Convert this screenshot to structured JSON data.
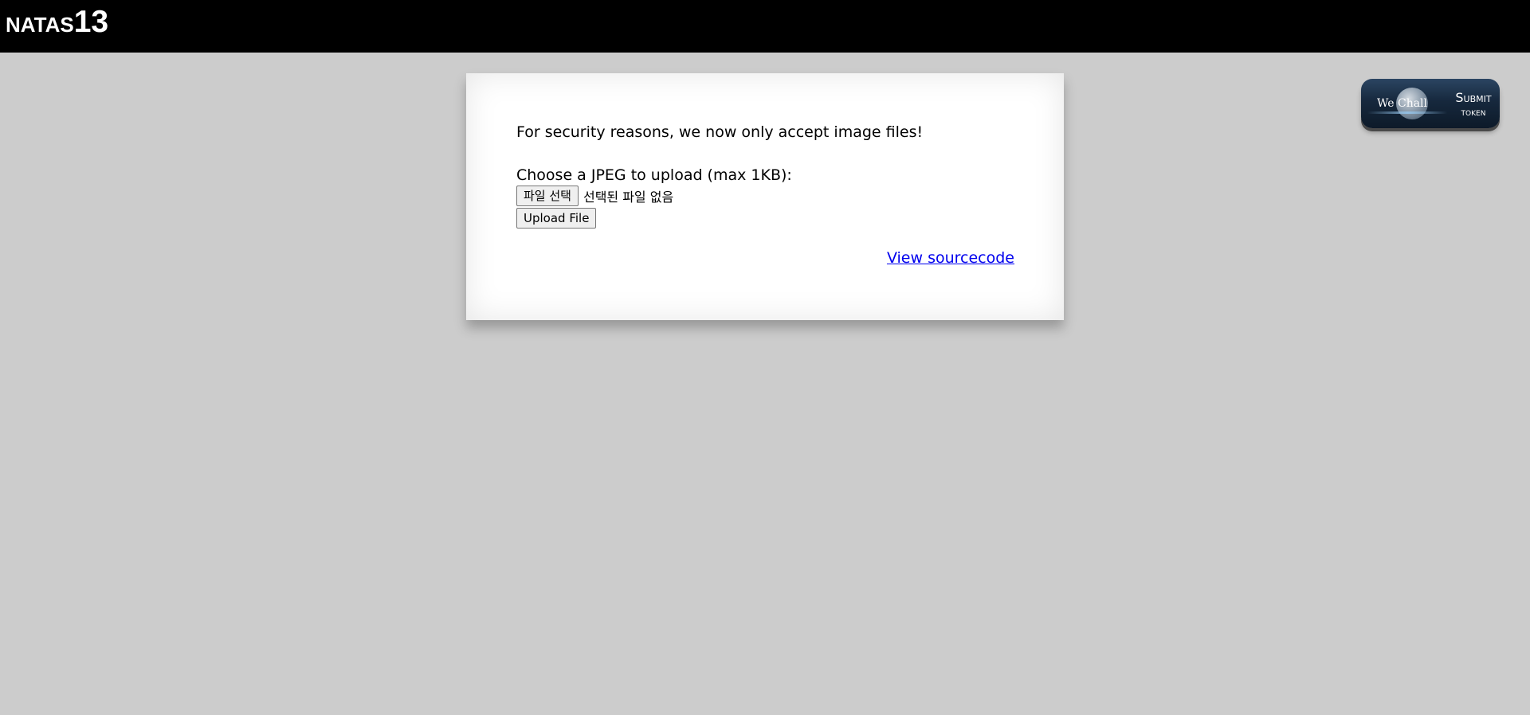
{
  "header": {
    "title_prefix": "NATAS",
    "title_level": "13"
  },
  "wechall": {
    "logo_text": "We Chall",
    "submit_line1": "Submit",
    "submit_line2": "token"
  },
  "content": {
    "notice": "For security reasons, we now only accept image files!",
    "choose_label": "Choose a JPEG to upload (max 1KB):",
    "file_button_label": "파일 선택",
    "no_file_text": "선택된 파일 없음",
    "upload_button_label": "Upload File",
    "view_source_label": "View sourcecode"
  },
  "colors": {
    "header_bg": "#000000",
    "page_bg": "#cccccc",
    "link": "#0000ee"
  }
}
